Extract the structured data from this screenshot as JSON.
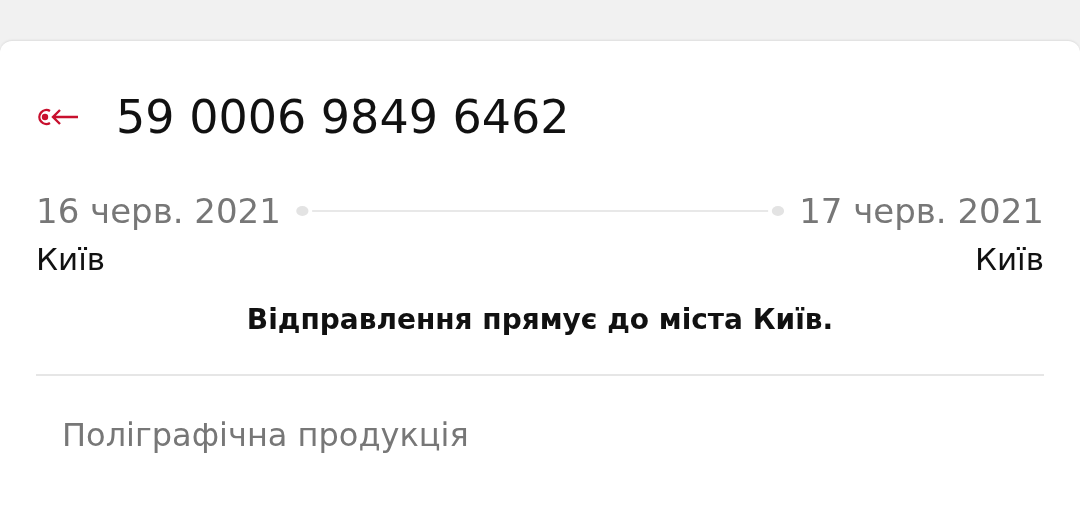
{
  "shipment": {
    "number": "59 0006 9849 6462",
    "departure": {
      "date": "16 черв. 2021",
      "city": "Київ"
    },
    "arrival": {
      "date": "17 черв. 2021",
      "city": "Київ"
    },
    "status": "Відправлення прямує до міста Київ.",
    "category": "Поліграфічна продукція"
  }
}
